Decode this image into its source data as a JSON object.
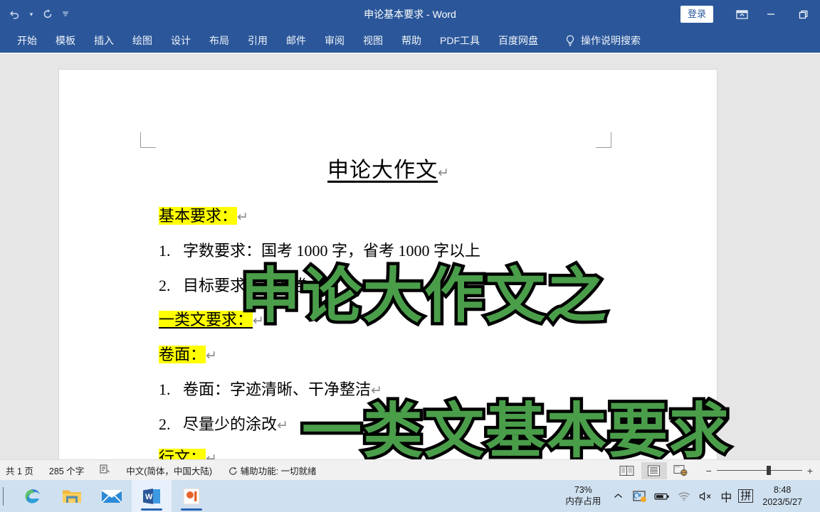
{
  "window": {
    "title": "申论基本要求 - Word",
    "signin_label": "登录",
    "quick_access": {
      "undo_icon": "undo-icon",
      "undo_dropdown_icon": "chevron-down-icon",
      "redo_icon": "redo-icon",
      "customize_icon": "customize-quick-access-icon"
    },
    "controls": {
      "ribbon_display_icon": "ribbon-display-options-icon",
      "minimize_icon": "minimize-icon",
      "restore_icon": "restore-icon"
    }
  },
  "ribbon": {
    "tabs": [
      {
        "label": "开始"
      },
      {
        "label": "模板"
      },
      {
        "label": "插入"
      },
      {
        "label": "绘图"
      },
      {
        "label": "设计"
      },
      {
        "label": "布局"
      },
      {
        "label": "引用"
      },
      {
        "label": "邮件"
      },
      {
        "label": "审阅"
      },
      {
        "label": "视图"
      },
      {
        "label": "帮助"
      },
      {
        "label": "PDF工具"
      },
      {
        "label": "百度网盘"
      }
    ],
    "tell_me": {
      "icon": "lightbulb-icon",
      "label": "操作说明搜索"
    }
  },
  "document": {
    "title": "申论大作文",
    "pilcrow": "↵",
    "lines": [
      {
        "num": "",
        "label": "基本要求：",
        "highlight": true,
        "underline": false,
        "rest": ""
      },
      {
        "num": "1.",
        "label": "字数要求：",
        "highlight": false,
        "underline": false,
        "rest": "国考 1000 字，省考 1000 字以上"
      },
      {
        "num": "2.",
        "label": "目标要求：",
        "highlight": false,
        "underline": false,
        "rest": "一类卷"
      },
      {
        "num": "",
        "label": "一类文要求：",
        "highlight": true,
        "underline": true,
        "rest": ""
      },
      {
        "num": "",
        "label": "卷面：",
        "highlight": true,
        "underline": false,
        "rest": ""
      },
      {
        "num": "1.",
        "label": "卷面：",
        "highlight": false,
        "underline": false,
        "rest": "字迹清晰、干净整洁"
      },
      {
        "num": "2.",
        "label": "尽量少的涂改",
        "highlight": false,
        "underline": false,
        "rest": ""
      },
      {
        "num": "",
        "label": "行文：",
        "highlight": true,
        "underline": false,
        "rest": ""
      }
    ]
  },
  "overlay": {
    "line1": "申论大作文之",
    "line2": "一类文基本要求",
    "fill_color": "#4a9e4a",
    "stroke_color": "#000000"
  },
  "status_bar": {
    "page_count": "共 1 页",
    "word_count": "285 个字",
    "proofing_icon": "proofing-errors-icon",
    "language": "中文(简体，中国大陆)",
    "accessibility_icon": "accessibility-icon",
    "accessibility": "辅助功能: 一切就绪",
    "views": [
      {
        "name": "read-mode",
        "active": false
      },
      {
        "name": "print-layout",
        "active": true
      },
      {
        "name": "web-layout",
        "active": false
      }
    ],
    "zoom_out_icon": "minus-icon",
    "zoom_in_icon": "plus-icon"
  },
  "taskbar": {
    "apps": [
      {
        "name": "edge",
        "active": false
      },
      {
        "name": "file-explorer",
        "active": false
      },
      {
        "name": "mail",
        "active": false
      },
      {
        "name": "word",
        "active": true
      },
      {
        "name": "powerpoint",
        "active": false
      }
    ],
    "tray": {
      "memory_percent": "73%",
      "memory_label": "内存占用",
      "chevron_icon": "show-hidden-icons-icon",
      "onedrive_icon": "onedrive-sync-icon",
      "battery_icon": "battery-icon",
      "network_icon": "wifi-icon",
      "volume_icon": "volume-muted-icon",
      "ime_mode": "中",
      "ime_pinyin": "拼",
      "time": "8:48",
      "date": "2023/5/27"
    }
  }
}
